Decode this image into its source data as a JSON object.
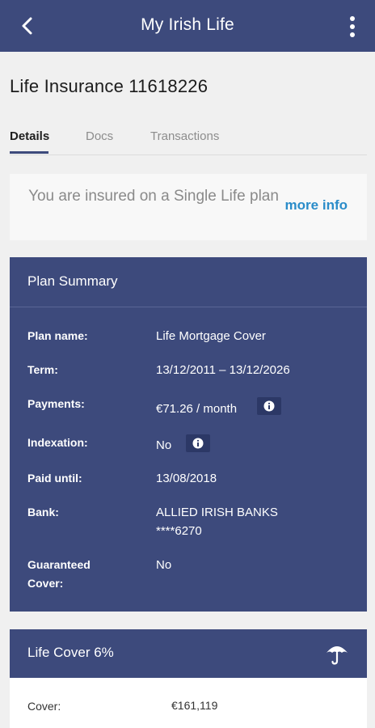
{
  "appbar": {
    "title": "My Irish Life",
    "back_icon": "back-arrow-icon",
    "menu_icon": "more-vertical-icon",
    "bg_color": "#3d4a7c"
  },
  "page": {
    "title": "Life Insurance 11618226"
  },
  "tabs": [
    {
      "label": "Details",
      "active": true
    },
    {
      "label": "Docs",
      "active": false
    },
    {
      "label": "Transactions",
      "active": false
    }
  ],
  "notice": {
    "text": "You are insured on a Single Life plan",
    "link": "more info",
    "link_color": "#2a8cc9"
  },
  "plan_summary": {
    "heading": "Plan Summary",
    "rows": [
      {
        "label": "Plan name:",
        "value": "Life Mortgage Cover"
      },
      {
        "label": "Term:",
        "value": "13/12/2011 – 13/12/2026"
      },
      {
        "label": "Payments:",
        "value": "€71.26 / month"
      },
      {
        "label": "Indexation:",
        "value": "No"
      },
      {
        "label": "Paid until:",
        "value": "13/08/2018"
      },
      {
        "label": "Bank:",
        "value_line1": "ALLIED IRISH BANKS",
        "value_line2": "****6270"
      },
      {
        "label_line1": "Guaranteed",
        "label_line2": "Cover:",
        "value": "No"
      }
    ]
  },
  "life_cover": {
    "heading": "Life Cover 6%",
    "icon": "umbrella-icon",
    "cover_label": "Cover:",
    "cover_value": "€161,119"
  }
}
